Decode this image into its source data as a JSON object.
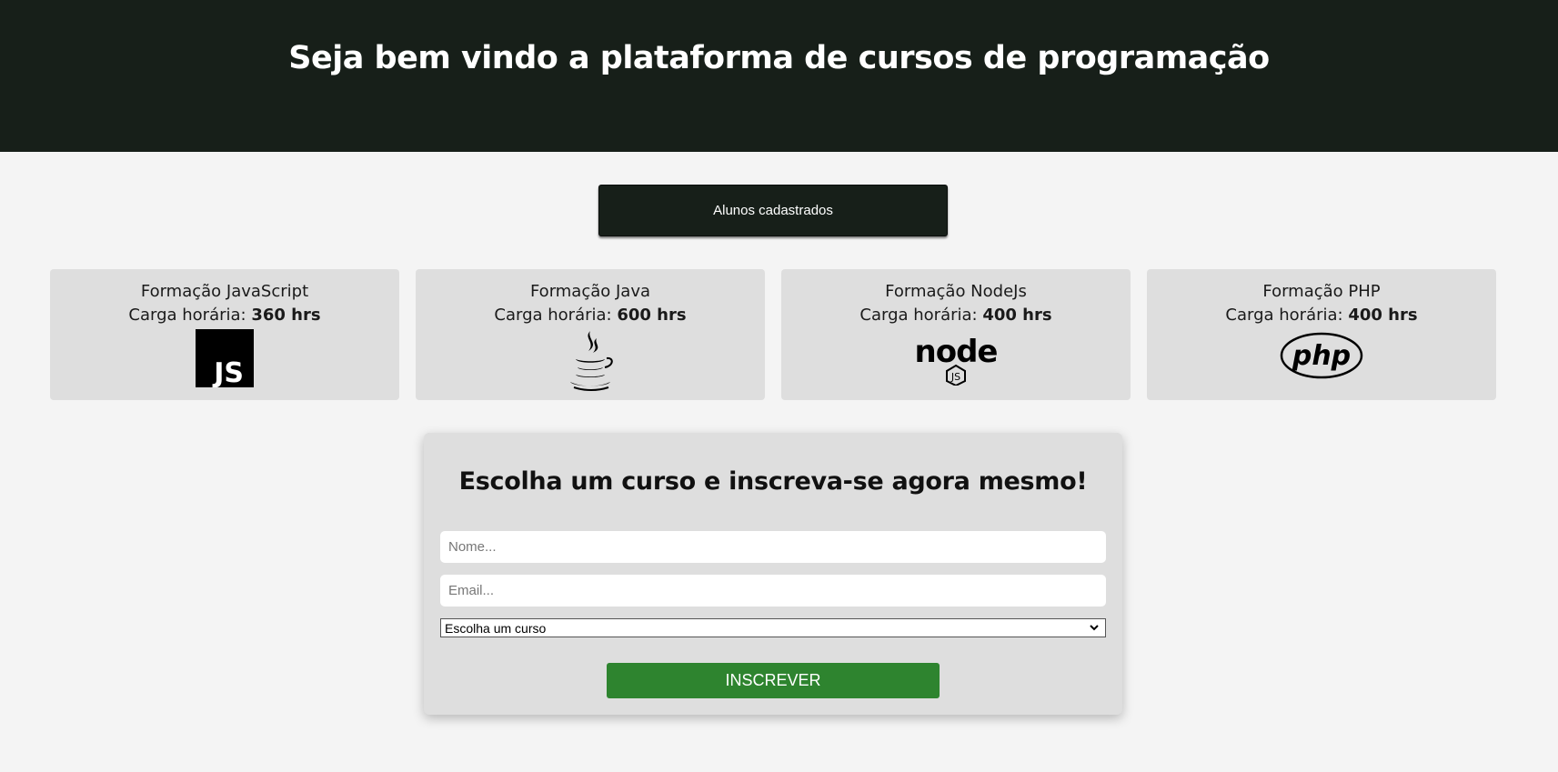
{
  "header": {
    "title": "Seja bem vindo a plataforma de cursos de programação"
  },
  "students_button": {
    "label": "Alunos cadastrados"
  },
  "courses": [
    {
      "title": "Formação JavaScript",
      "hours_label": "Carga horária:",
      "hours_value": "360 hrs",
      "icon": "javascript-icon",
      "logo_text": "JS"
    },
    {
      "title": "Formação Java",
      "hours_label": "Carga horária:",
      "hours_value": "600 hrs",
      "icon": "java-icon"
    },
    {
      "title": "Formação NodeJs",
      "hours_label": "Carga horária:",
      "hours_value": "400 hrs",
      "icon": "nodejs-icon",
      "logo_text": "node",
      "logo_subtext": "JS"
    },
    {
      "title": "Formação PHP",
      "hours_label": "Carga horária:",
      "hours_value": "400 hrs",
      "icon": "php-icon",
      "logo_text": "php"
    }
  ],
  "form": {
    "title": "Escolha um curso e inscreva-se agora mesmo!",
    "name_placeholder": "Nome...",
    "email_placeholder": "Email...",
    "select_value": "Escolha um curso",
    "submit_label": "INSCREVER"
  },
  "colors": {
    "header_bg": "#171f19",
    "card_bg": "#dedede",
    "page_bg": "#f4f4f4",
    "submit_bg": "#2e842f"
  }
}
